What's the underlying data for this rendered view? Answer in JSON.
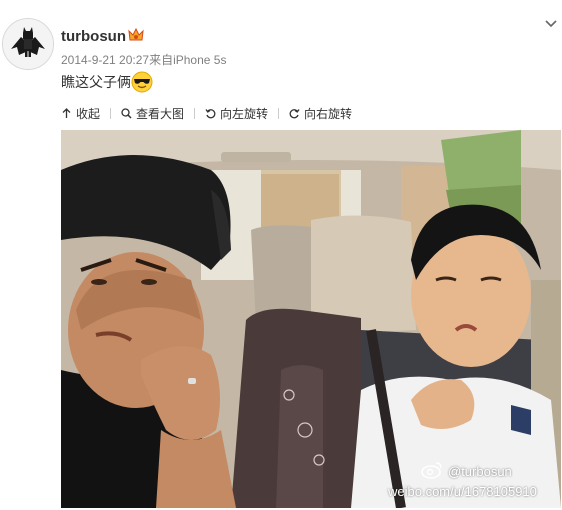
{
  "user": {
    "name": "turbosun",
    "badge_icon": "vip-crown-icon"
  },
  "post": {
    "timestamp": "2014-9-21 20:27",
    "source": "来自iPhone 5s",
    "text": "瞧这父子俩",
    "emoji": "sunglasses-emoji"
  },
  "toolbar": {
    "collapse_label": "收起",
    "view_large_label": "查看大图",
    "rotate_left_label": "向左旋转",
    "rotate_right_label": "向右旋转"
  },
  "photo": {
    "watermark_handle": "@turbosun",
    "watermark_url": "weibo.com/u/1678105910"
  },
  "colors": {
    "text": "#333333",
    "meta": "#808080",
    "separator": "#cccccc"
  }
}
